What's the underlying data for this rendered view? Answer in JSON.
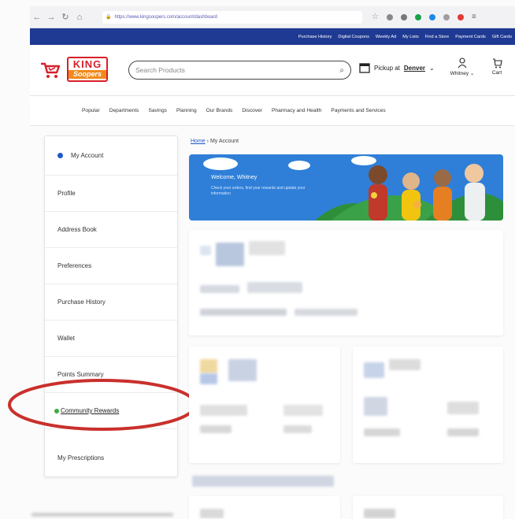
{
  "browser": {
    "back_icon": "back-arrow-icon",
    "forward_icon": "forward-arrow-icon",
    "reload_icon": "reload-icon",
    "home_icon": "home-icon",
    "url": "https://www.kingsoopers.com/account/dashboard"
  },
  "utility_links": [
    "Purchase History",
    "Digital Coupons",
    "Weekly Ad",
    "My Lists",
    "Find a Store",
    "Payment Cards",
    "Gift Cards"
  ],
  "header": {
    "brand_top": "KING",
    "brand_bottom": "Soopers",
    "search_placeholder": "Search Products",
    "pickup_label": "Pickup at",
    "pickup_store": "Denver",
    "account_name": "Whitney",
    "cart_label": "Cart"
  },
  "nav": [
    "Popular",
    "Departments",
    "Savings",
    "Planning",
    "Our Brands",
    "Discover",
    "Pharmacy and Health",
    "Payments and Services"
  ],
  "sidebar": {
    "items": [
      {
        "label": "My Account"
      },
      {
        "label": "Profile"
      },
      {
        "label": "Address Book"
      },
      {
        "label": "Preferences"
      },
      {
        "label": "Purchase History"
      },
      {
        "label": "Wallet"
      },
      {
        "label": "Points Summary"
      },
      {
        "label": "Community Rewards"
      },
      {
        "label": "My Prescriptions"
      }
    ]
  },
  "breadcrumb": {
    "home": "Home",
    "separator": "›",
    "current": "My Account"
  },
  "banner": {
    "welcome": "Welcome, Whitney",
    "subtitle": "Check your orders, find your rewards and update your information"
  },
  "colors": {
    "brand_red": "#d8202a",
    "utility_blue": "#1f3a93",
    "banner_blue": "#2f7fd8",
    "highlight_red": "#c9302c"
  }
}
